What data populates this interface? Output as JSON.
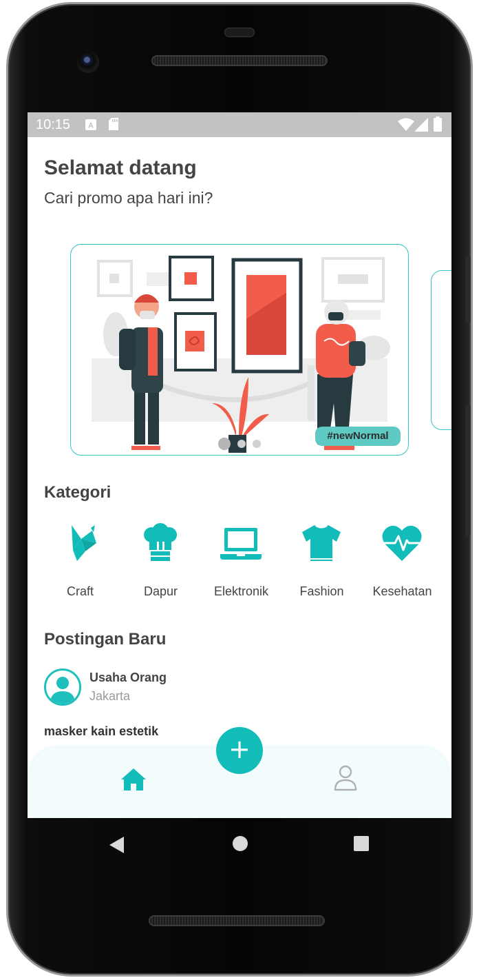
{
  "status_bar": {
    "time": "10:15",
    "icons": [
      "a-notification-icon",
      "sd-card-icon",
      "wifi-icon",
      "cell-signal-icon",
      "battery-icon"
    ]
  },
  "header": {
    "title": "Selamat datang",
    "subtitle": "Cari promo apa hari ini?"
  },
  "banner": {
    "tag": "#newNormal",
    "active_slide": 0,
    "slide_count": 3
  },
  "categories": {
    "title": "Kategori",
    "items": [
      {
        "label": "Craft",
        "icon": "origami-bird-icon"
      },
      {
        "label": "Dapur",
        "icon": "chef-hat-icon"
      },
      {
        "label": "Elektronik",
        "icon": "laptop-icon"
      },
      {
        "label": "Fashion",
        "icon": "tshirt-icon"
      },
      {
        "label": "Kesehatan",
        "icon": "heart-pulse-icon"
      }
    ]
  },
  "posts": {
    "title": "Postingan Baru",
    "items": [
      {
        "author": "Usaha Orang",
        "location": "Jakarta",
        "title": "masker kain estetik"
      }
    ]
  },
  "bottom_nav": {
    "items": [
      "home-icon",
      "profile-icon"
    ],
    "fab_label": "+"
  },
  "colors": {
    "accent": "#12bcb9",
    "text": "#444444",
    "muted": "#9a9a9a",
    "status_bar": "#c2c2c2",
    "nav_background": "#f3fcfd",
    "illustration_red": "#f25c4a"
  }
}
